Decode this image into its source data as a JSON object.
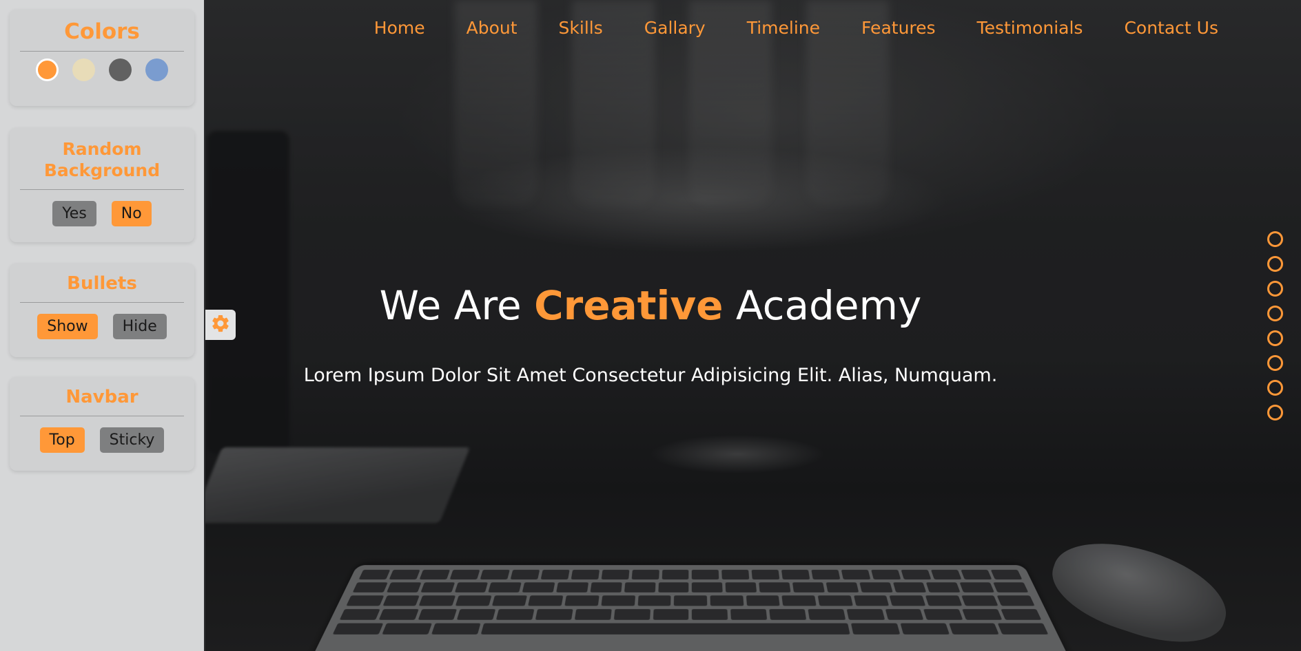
{
  "nav": {
    "items": [
      {
        "label": "Home"
      },
      {
        "label": "About"
      },
      {
        "label": "Skills"
      },
      {
        "label": "Gallary"
      },
      {
        "label": "Timeline"
      },
      {
        "label": "Features"
      },
      {
        "label": "Testimonials"
      },
      {
        "label": "Contact Us"
      }
    ]
  },
  "hero": {
    "title_before": "We Are ",
    "title_accent": "Creative",
    "title_after": " Academy",
    "subtitle": "Lorem Ipsum Dolor Sit Amet Consectetur Adipisicing Elit. Alias, Numquam."
  },
  "settings": {
    "colors": {
      "title": "Colors",
      "swatches": [
        "#ff9838",
        "#e8dcb8",
        "#616161",
        "#7a9ccf"
      ],
      "active_index": 0
    },
    "random_background": {
      "title": "Random Background",
      "yes_label": "Yes",
      "no_label": "No",
      "selected": "No"
    },
    "bullets": {
      "title": "Bullets",
      "show_label": "Show",
      "hide_label": "Hide",
      "selected": "Show"
    },
    "navbar": {
      "title": "Navbar",
      "top_label": "Top",
      "sticky_label": "Sticky",
      "selected": "Top"
    }
  },
  "bullets": {
    "count": 8
  },
  "theme": {
    "accent": "#ff9838"
  }
}
